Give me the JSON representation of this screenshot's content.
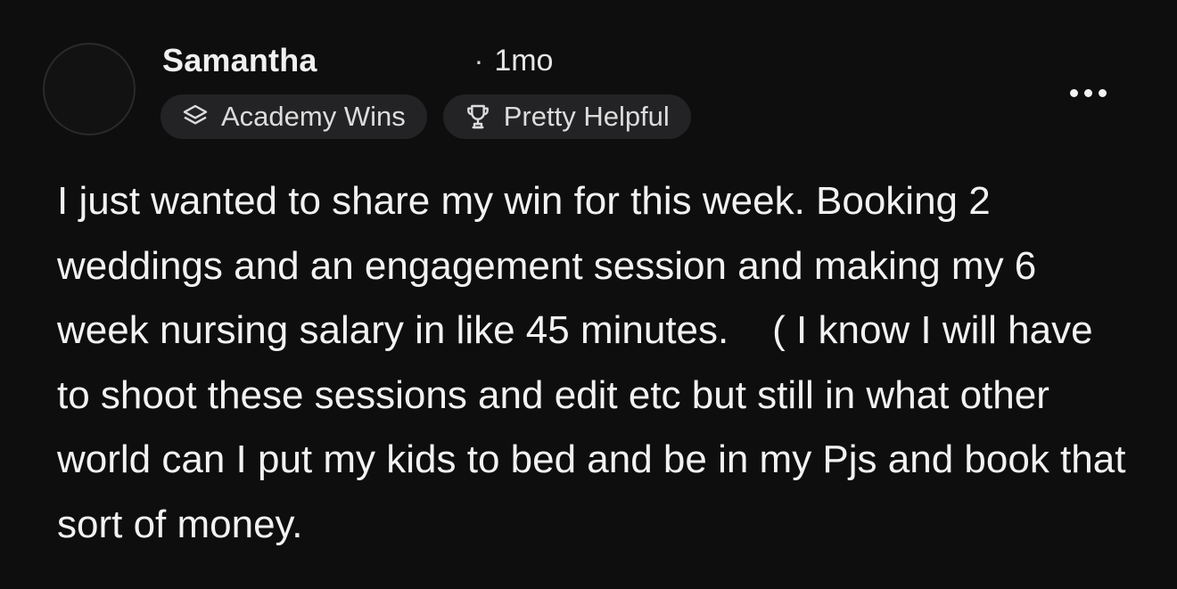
{
  "post": {
    "author": {
      "name": "Samantha",
      "timestamp": "1mo",
      "separator": "·"
    },
    "badges": [
      {
        "icon": "layers-icon",
        "label": "Academy Wins"
      },
      {
        "icon": "trophy-icon",
        "label": "Pretty Helpful"
      }
    ],
    "more_menu": {
      "icon": "more-horizontal-icon"
    },
    "body": "I just wanted to share my win for this week. Booking 2 weddings and an engagement session and making my 6 week nursing salary in like 45 minutes.    ( I know I will have to shoot these sessions and edit etc but still in what other world can I put my kids to bed and be in my Pjs and book that sort of money."
  },
  "colors": {
    "background": "#0e0e0f",
    "text": "#f2f2f2",
    "badge_background": "#232325",
    "avatar_border": "#2a2a2c"
  }
}
